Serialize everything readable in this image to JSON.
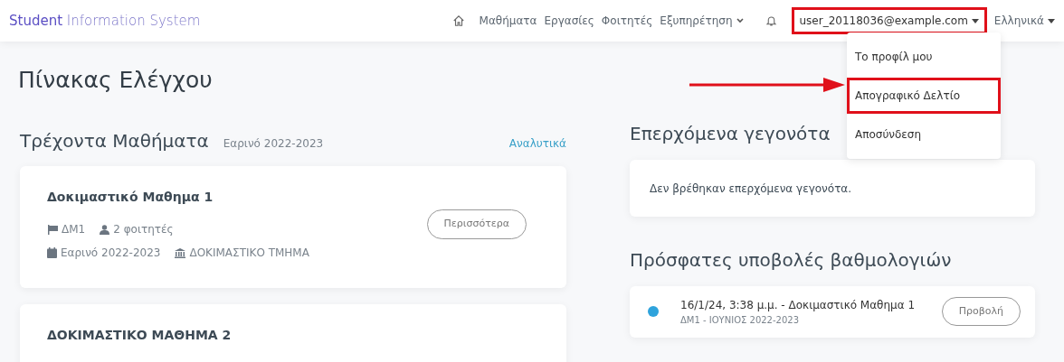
{
  "brand": {
    "bold": "Student",
    "rest": "Information System"
  },
  "nav": [
    {
      "label": "Μαθήματα",
      "kind": "link"
    },
    {
      "label": "Εργασίες",
      "kind": "link"
    },
    {
      "label": "Φοιτητές",
      "kind": "link"
    },
    {
      "label": "Εξυπηρέτηση",
      "kind": "dropdown"
    }
  ],
  "user_menu": {
    "label": "user_20118036@example.com",
    "highlighted": true,
    "expanded": true,
    "items": [
      {
        "label": "Το προφίλ μου",
        "highlighted": false
      },
      {
        "label": "Απογραφικό Δελτίο",
        "highlighted": true
      },
      {
        "label": "Αποσύνδεση",
        "highlighted": false
      }
    ]
  },
  "language": "Ελληνικά",
  "page_title": "Πίνακας Ελέγχου",
  "courses": {
    "title": "Τρέχοντα Μαθήματα",
    "period": "Εαρινό 2022-2023",
    "link": "Αναλυτικά",
    "items": [
      {
        "name": "Δοκιμαστικό Μαθημα 1",
        "code": "ΔΜ1",
        "students": "2 φοιτητές",
        "period": "Εαρινό 2022-2023",
        "department": "ΔΟΚΙΜΑΣΤΙΚΟ ΤΜΗΜΑ",
        "button": "Περισσότερα"
      },
      {
        "name": "ΔΟΚΙΜΑΣΤΙΚΟ ΜΑΘΗΜΑ 2"
      }
    ]
  },
  "events": {
    "title": "Επερχόμενα γεγονότα",
    "empty": "Δεν βρέθηκαν επερχόμενα γεγονότα."
  },
  "grades": {
    "title": "Πρόσφατες υποβολές βαθμολογιών",
    "items": [
      {
        "title": "16/1/24, 3:38 μ.μ. - Δοκιμαστικό Μαθημα 1",
        "subtitle": "ΔΜ1 - ΙΟΥΝΙΟΣ 2022-2023",
        "color": "#2ea3dc",
        "button": "Προβολή"
      }
    ]
  }
}
